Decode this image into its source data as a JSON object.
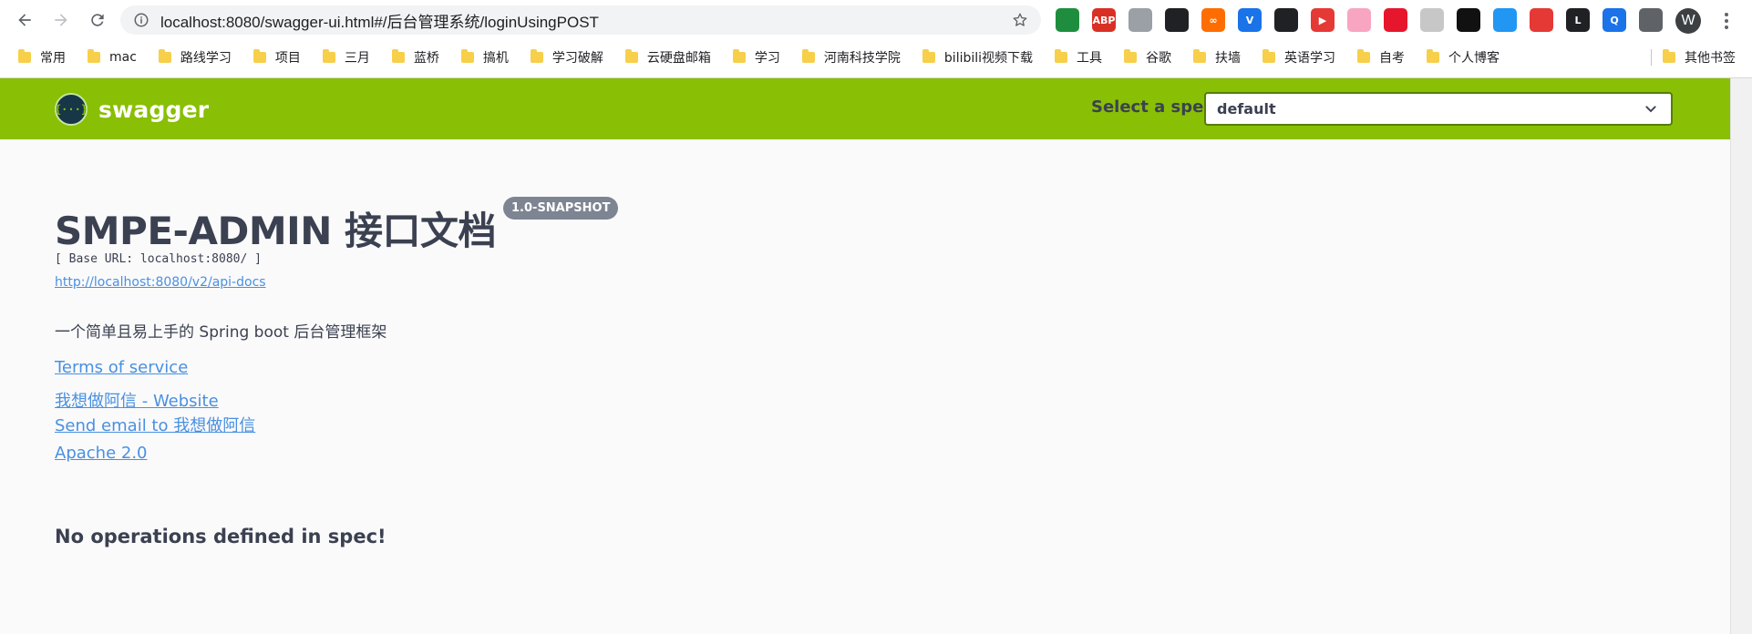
{
  "browser": {
    "url": "localhost:8080/swagger-ui.html#/后台管理系统/loginUsingPOST",
    "profile_initial": "W",
    "extensions": [
      {
        "icon": "android-icon",
        "text": "",
        "color": "#1e8e3e"
      },
      {
        "icon": "adblock-plus-icon",
        "text": "ABP",
        "color": "#d93025"
      },
      {
        "icon": "screenshot-icon",
        "text": "",
        "color": "#9aa0a6"
      },
      {
        "icon": "link-icon",
        "text": "",
        "color": "#202124"
      },
      {
        "icon": "infinity-icon",
        "text": "∞",
        "color": "#ff6d00"
      },
      {
        "icon": "v-icon",
        "text": "V",
        "color": "#1a73e8"
      },
      {
        "icon": "tampermonkey-icon",
        "text": "",
        "color": "#202124"
      },
      {
        "icon": "youtube-icon",
        "text": "▶",
        "color": "#e53935"
      },
      {
        "icon": "bilibili-icon",
        "text": "",
        "color": "#f8a5c2"
      },
      {
        "icon": "weibo-icon",
        "text": "",
        "color": "#e6162d"
      },
      {
        "icon": "ghost-icon",
        "text": "",
        "color": "#c7c7c7"
      },
      {
        "icon": "key-icon",
        "text": "",
        "color": "#111111"
      },
      {
        "icon": "sidebar-icon",
        "text": "",
        "color": "#2196f3"
      },
      {
        "icon": "block-icon",
        "text": "",
        "color": "#e53935"
      },
      {
        "icon": "l-icon",
        "text": "L",
        "color": "#202124"
      },
      {
        "icon": "q-icon",
        "text": "Q",
        "color": "#1a73e8"
      },
      {
        "icon": "puzzle-icon",
        "text": "",
        "color": "#5f6368"
      }
    ],
    "bookmarks": [
      "常用",
      "mac",
      "路线学习",
      "项目",
      "三月",
      "蓝桥",
      "搞机",
      "学习破解",
      "云硬盘邮箱",
      "学习",
      "河南科技学院",
      "bilibili视频下载",
      "工具",
      "谷歌",
      "扶墙",
      "英语学习",
      "自考",
      "个人博客"
    ],
    "other_bookmarks": "其他书签"
  },
  "swagger": {
    "logo_text": "swagger",
    "spec_label": "Select a spec",
    "spec_value": "default",
    "title": "SMPE-ADMIN 接口文档",
    "version": "1.0-SNAPSHOT",
    "base_url": "[ Base URL: localhost:8080/ ]",
    "api_docs_url": "http://localhost:8080/v2/api-docs",
    "description": "一个简单且易上手的 Spring boot 后台管理框架",
    "terms": "Terms of service",
    "website": "我想做阿信 - Website",
    "email": "Send email to 我想做阿信",
    "license": "Apache 2.0",
    "no_ops": "No operations defined in spec!"
  },
  "colors": {
    "topbar": "#89bf04",
    "title_text": "#3b4151",
    "link": "#4990e2",
    "badge": "#7d8492"
  }
}
